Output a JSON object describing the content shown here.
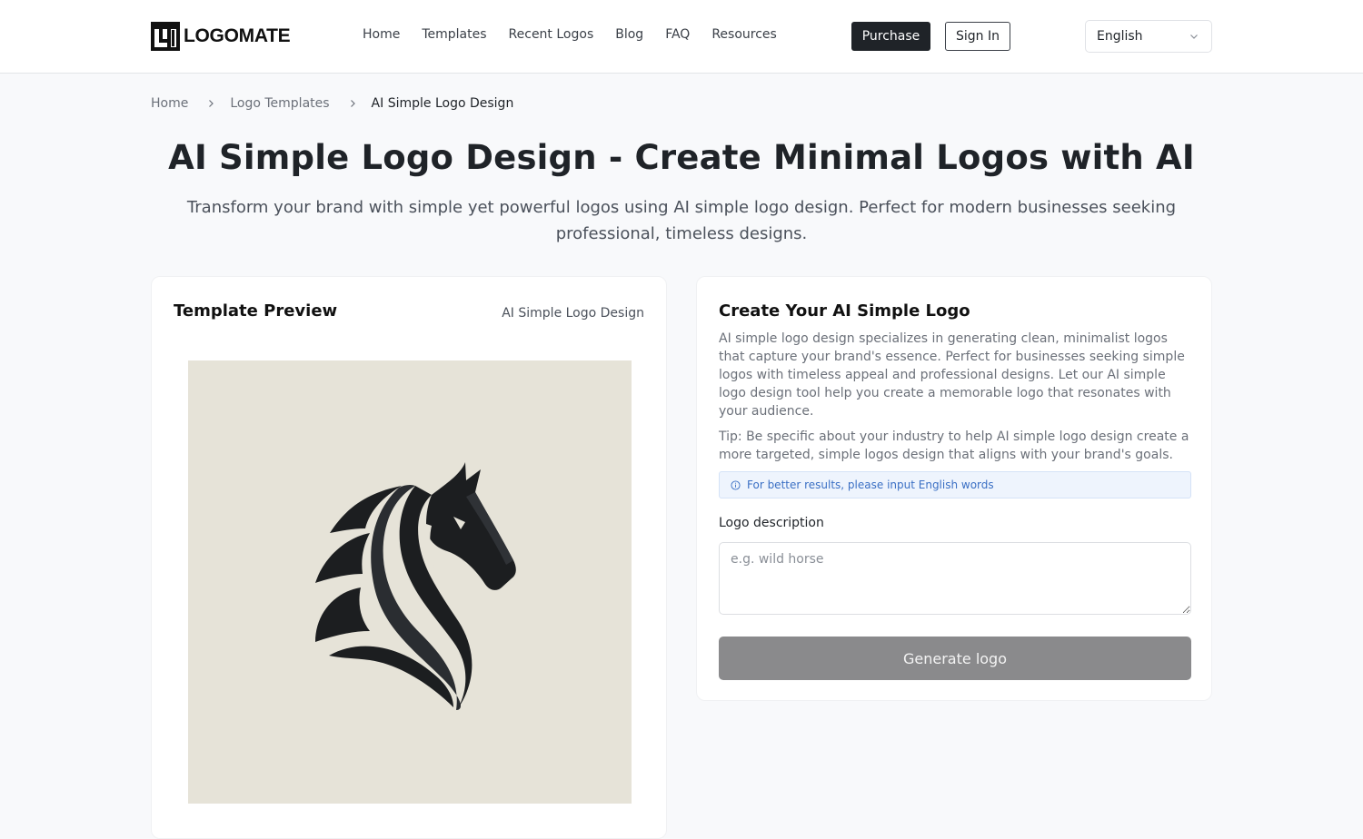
{
  "header": {
    "logo_text": "LOGOMATE",
    "nav": [
      {
        "label": "Home"
      },
      {
        "label": "Templates"
      },
      {
        "label": "Recent Logos"
      },
      {
        "label": "Blog"
      },
      {
        "label": "FAQ"
      },
      {
        "label": "Resources"
      }
    ],
    "purchase_label": "Purchase",
    "signin_label": "Sign In",
    "language": {
      "selected": "English",
      "icon": "chevron-down-icon"
    }
  },
  "breadcrumb": {
    "items": [
      {
        "label": "Home"
      },
      {
        "label": "Logo Templates"
      },
      {
        "label": "AI Simple Logo Design"
      }
    ],
    "separator_icon": "chevron-right-icon"
  },
  "hero": {
    "title": "AI Simple Logo Design - Create Minimal Logos with AI",
    "subtitle": "Transform your brand with simple yet powerful logos using AI simple logo design. Perfect for modern businesses seeking professional, timeless designs."
  },
  "preview": {
    "title": "Template Preview",
    "tag": "AI Simple Logo Design",
    "image_alt": "Stylized black horse head logo on beige background",
    "colors": {
      "background": "#e6e3d8",
      "mark": "#1c1e20",
      "mark_highlight": "#2f3236"
    }
  },
  "create": {
    "title": "Create Your AI Simple Logo",
    "description": "AI simple logo design specializes in generating clean, minimalist logos that capture your brand's essence. Perfect for businesses seeking simple logos with timeless appeal and professional designs. Let our AI simple logo design tool help you create a memorable logo that resonates with your audience.",
    "tip": "Tip: Be specific about your industry to help AI simple logo design create a more targeted, simple logos design that aligns with your brand's goals.",
    "info": {
      "icon": "info-circle-icon",
      "text": "For better results, please input English words"
    },
    "field_label": "Logo description",
    "field_placeholder": "e.g. wild horse",
    "field_value": "",
    "generate_label": "Generate logo"
  }
}
